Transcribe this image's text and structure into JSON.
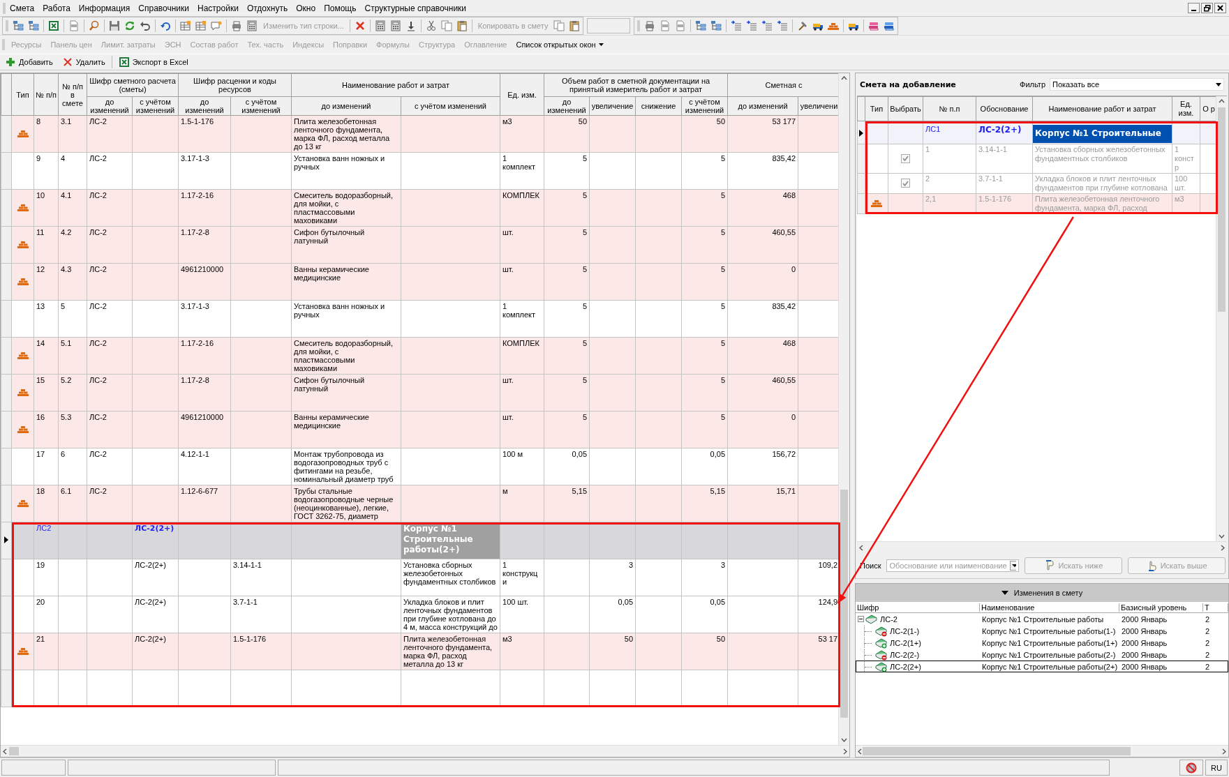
{
  "menu": [
    "Смета",
    "Работа",
    "Информация",
    "Справочники",
    "Настройки",
    "Отдохнуть",
    "Окно",
    "Помощь",
    "Структурные справочники"
  ],
  "toolbar": {
    "buttons": [
      {
        "label": "Изменить тип строки...",
        "disabled": true
      },
      {
        "label": "Копировать в смету",
        "disabled": true
      }
    ]
  },
  "panel_tabs": [
    {
      "label": "Ресурсы",
      "disabled": true
    },
    {
      "label": "Панель цен",
      "disabled": true
    },
    {
      "label": "Лимит. затраты",
      "disabled": true
    },
    {
      "label": "ЭСН",
      "disabled": true
    },
    {
      "label": "Состав работ",
      "disabled": true
    },
    {
      "label": "Тех. часть",
      "disabled": true
    },
    {
      "label": "Индексы",
      "disabled": true
    },
    {
      "label": "Поправки",
      "disabled": true
    },
    {
      "label": "Формулы",
      "disabled": true
    },
    {
      "label": "Структура",
      "disabled": true
    },
    {
      "label": "Оглавление",
      "disabled": true
    },
    {
      "label": "Список открытых окон",
      "disabled": false
    }
  ],
  "actions": [
    {
      "label": "Добавить",
      "kind": "add"
    },
    {
      "label": "Удалить",
      "kind": "delete"
    },
    {
      "label": "Экспорт в Excel",
      "kind": "excel"
    }
  ],
  "estimate_table": {
    "columns": [
      {
        "label": "Тип"
      },
      {
        "label": "№ п/п"
      },
      {
        "label": "№ п/п в смете"
      },
      {
        "label": "Шифр сметного расчета (сметы)",
        "colspan": 2,
        "sub": [
          "до изменений",
          "с учётом изменений"
        ]
      },
      {
        "label": "Шифр расценки и коды ресурсов",
        "colspan": 2,
        "sub": [
          "до изменений",
          "с учётом изменений"
        ]
      },
      {
        "label": "Наименование работ и затрат",
        "colspan": 2,
        "sub": [
          "до изменений",
          "с учётом изменений"
        ]
      },
      {
        "label": "Ед. изм."
      },
      {
        "label": "Объем работ в сметной документации на принятый измеритель работ и затрат",
        "colspan": 4,
        "sub": [
          "до изменений",
          "увеличение",
          "снижение",
          "с учётом изменений"
        ]
      },
      {
        "label": "Сметная с",
        "colspan": 2,
        "sub": [
          "до изменений",
          "увеличени"
        ]
      }
    ],
    "rows": [
      {
        "kind": "material",
        "selected": false,
        "cells": [
          "",
          "8",
          "3.1",
          "ЛС-2",
          "",
          "1.5-1-176",
          "",
          "Плита железобетонная ленточного фундамента, марка ФЛ, расход металла до 13 кг",
          "",
          "м3",
          "50",
          "",
          "",
          "50",
          "53 177",
          ""
        ]
      },
      {
        "kind": "work",
        "selected": false,
        "cells": [
          "",
          "9",
          "4",
          "ЛС-2",
          "",
          "3.17-1-3",
          "",
          "Установка ванн ножных и ручных",
          "",
          "1 комплект",
          "5",
          "",
          "",
          "5",
          "835,42",
          ""
        ]
      },
      {
        "kind": "material",
        "selected": false,
        "cells": [
          "",
          "10",
          "4.1",
          "ЛС-2",
          "",
          "1.17-2-16",
          "",
          "Смеситель водоразборный, для мойки, с пластмассовыми маховиками",
          "",
          "КОМПЛЕК",
          "5",
          "",
          "",
          "5",
          "468",
          ""
        ]
      },
      {
        "kind": "material",
        "selected": false,
        "cells": [
          "",
          "11",
          "4.2",
          "ЛС-2",
          "",
          "1.17-2-8",
          "",
          "Сифон бутылочный латунный",
          "",
          "шт.",
          "5",
          "",
          "",
          "5",
          "460,55",
          ""
        ]
      },
      {
        "kind": "material",
        "selected": false,
        "cells": [
          "",
          "12",
          "4.3",
          "ЛС-2",
          "",
          "4961210000",
          "",
          "Ванны керамические медицинские",
          "",
          "шт.",
          "5",
          "",
          "",
          "5",
          "0",
          ""
        ]
      },
      {
        "kind": "work",
        "selected": false,
        "cells": [
          "",
          "13",
          "5",
          "ЛС-2",
          "",
          "3.17-1-3",
          "",
          "Установка ванн ножных и ручных",
          "",
          "1 комплект",
          "5",
          "",
          "",
          "5",
          "835,42",
          ""
        ]
      },
      {
        "kind": "material",
        "selected": false,
        "cells": [
          "",
          "14",
          "5.1",
          "ЛС-2",
          "",
          "1.17-2-16",
          "",
          "Смеситель водоразборный, для мойки, с пластмассовыми маховиками",
          "",
          "КОМПЛЕК",
          "5",
          "",
          "",
          "5",
          "468",
          ""
        ]
      },
      {
        "kind": "material",
        "selected": false,
        "cells": [
          "",
          "15",
          "5.2",
          "ЛС-2",
          "",
          "1.17-2-8",
          "",
          "Сифон бутылочный латунный",
          "",
          "шт.",
          "5",
          "",
          "",
          "5",
          "460,55",
          ""
        ]
      },
      {
        "kind": "material",
        "selected": false,
        "cells": [
          "",
          "16",
          "5.3",
          "ЛС-2",
          "",
          "4961210000",
          "",
          "Ванны керамические медицинские",
          "",
          "шт.",
          "5",
          "",
          "",
          "5",
          "0",
          ""
        ]
      },
      {
        "kind": "work",
        "selected": false,
        "cells": [
          "",
          "17",
          "6",
          "ЛС-2",
          "",
          "4.12-1-1",
          "",
          "Монтаж трубопровода из водогазопроводных труб с фитингами на резьбе, номинальный диаметр труб",
          "",
          "100 м",
          "0,05",
          "",
          "",
          "0,05",
          "156,72",
          ""
        ]
      },
      {
        "kind": "material",
        "selected": false,
        "cells": [
          "",
          "18",
          "6.1",
          "ЛС-2",
          "",
          "1.12-6-677",
          "",
          "Трубы стальные водогазопроводные черные (неоцинкованные), легкие, ГОСТ 3262-75, диаметр",
          "",
          "м",
          "5,15",
          "",
          "",
          "5,15",
          "15,71",
          ""
        ]
      },
      {
        "kind": "group",
        "selected": true,
        "cells": [
          "",
          "ЛС2",
          "",
          "",
          "ЛС-2(2+)",
          "",
          "",
          "",
          "Корпус №1 Строительные работы(2+)",
          "",
          "",
          "",
          "",
          "",
          "",
          ""
        ]
      },
      {
        "kind": "work",
        "selected": false,
        "cells": [
          "",
          "19",
          "",
          "",
          "ЛС-2(2+)",
          "",
          "3.14-1-1",
          "",
          "Установка сборных железобетонных фундаментных столбиков",
          "1 конструкци",
          "",
          "3",
          "",
          "3",
          "",
          "109,2"
        ]
      },
      {
        "kind": "work",
        "selected": false,
        "cells": [
          "",
          "20",
          "",
          "",
          "ЛС-2(2+)",
          "",
          "3.7-1-1",
          "",
          "Укладка блоков и плит ленточных фундаментов при глубине котлована до 4 м, масса конструкций до",
          "100 шт.",
          "",
          "0,05",
          "",
          "0,05",
          "",
          "124,9"
        ]
      },
      {
        "kind": "material",
        "selected": false,
        "cells": [
          "",
          "21",
          "",
          "",
          "ЛС-2(2+)",
          "",
          "1.5-1-176",
          "",
          "Плита железобетонная ленточного фундамента, марка ФЛ, расход металла до 13 кг",
          "м3",
          "",
          "50",
          "",
          "50",
          "",
          "53 17"
        ]
      },
      {
        "kind": "empty",
        "selected": false,
        "cells": [
          "",
          "",
          "",
          "",
          "",
          "",
          "",
          "",
          "",
          "",
          "",
          "",
          "",
          "",
          "",
          ""
        ]
      }
    ]
  },
  "add_panel": {
    "title": "Смета на добавление",
    "filter": {
      "label": "Фильтр",
      "value": "Показать все"
    },
    "columns": [
      "Тип",
      "Выбрать",
      "№ п.п",
      "Обоснование",
      "Наименование работ и затрат",
      "Ед. изм.",
      "О р"
    ],
    "rows": [
      {
        "kind": "group",
        "selected": true,
        "disabled": false,
        "cells": [
          "",
          "",
          "ЛС1",
          "ЛС-2(2+)",
          "Корпус №1 Строительные",
          ""
        ]
      },
      {
        "kind": "work",
        "selected": false,
        "disabled": true,
        "checked": true,
        "cells": [
          "",
          "",
          "1",
          "3.14-1-1",
          "Установка сборных железобетонных фундаментных столбиков",
          "1 констр"
        ]
      },
      {
        "kind": "work",
        "selected": false,
        "disabled": true,
        "checked": true,
        "cells": [
          "",
          "",
          "2",
          "3.7-1-1",
          "Укладка блоков и плит ленточных фундаментов при глубине котлована",
          "100 шт."
        ]
      },
      {
        "kind": "material",
        "selected": false,
        "disabled": true,
        "cells": [
          "",
          "",
          "2,1",
          "1.5-1-176",
          "Плита железобетонная ленточного фундамента, марка ФЛ, расход",
          "м3"
        ]
      }
    ],
    "search": {
      "label": "Поиск",
      "placeholder": "Обоснование или наименование",
      "buttons": [
        {
          "label": "Искать ниже",
          "kind": "down",
          "disabled": true
        },
        {
          "label": "Искать выше",
          "kind": "up",
          "disabled": true
        }
      ]
    }
  },
  "changes_panel": {
    "title": "Изменения в смету",
    "expanded": true,
    "columns": [
      "Шифр",
      "Наименование",
      "Базисный уровень",
      "Т"
    ],
    "tree": [
      {
        "code": "ЛС-2",
        "name": "Корпус №1 Строительные работы",
        "base_level": "2000 Январь",
        "column_4": "2",
        "kind": "root",
        "selected": false,
        "expanded": true,
        "children": [
          {
            "code": "ЛС-2(1-)",
            "name": "Корпус №1 Строительные работы(1-)",
            "base_level": "2000 Январь",
            "column_4": "2",
            "kind": "minus",
            "selected": false
          },
          {
            "code": "ЛС-2(1+)",
            "name": "Корпус №1 Строительные работы(1+)",
            "base_level": "2000 Январь",
            "column_4": "2",
            "kind": "plus",
            "selected": false
          },
          {
            "code": "ЛС-2(2-)",
            "name": "Корпус №1 Строительные работы(2-)",
            "base_level": "2000 Январь",
            "column_4": "2",
            "kind": "minus",
            "selected": false
          },
          {
            "code": "ЛС-2(2+)",
            "name": "Корпус №1 Строительные работы(2+)",
            "base_level": "2000 Январь",
            "column_4": "2",
            "kind": "plus",
            "selected": true
          }
        ]
      }
    ]
  },
  "status_bar": {
    "language": "RU"
  }
}
